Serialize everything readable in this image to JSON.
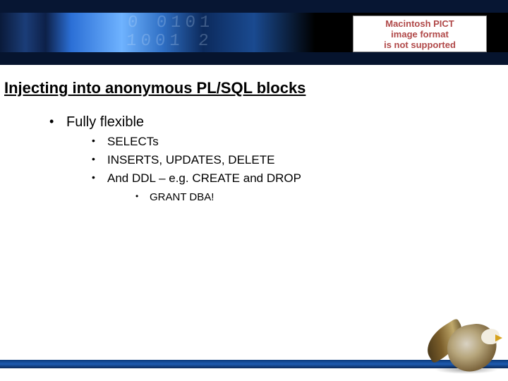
{
  "banner": {
    "pict_line1": "Macintosh PICT",
    "pict_line2": "image format",
    "pict_line3": "is not supported",
    "digits": "0 0101\n1001 2"
  },
  "title": "Injecting into anonymous PL/SQL blocks",
  "bullets": {
    "item1": "Fully flexible",
    "sub1": "SELECTs",
    "sub2": "INSERTS, UPDATES, DELETE",
    "sub3": "And DDL – e.g. CREATE and DROP",
    "subsub1": "GRANT DBA!"
  }
}
